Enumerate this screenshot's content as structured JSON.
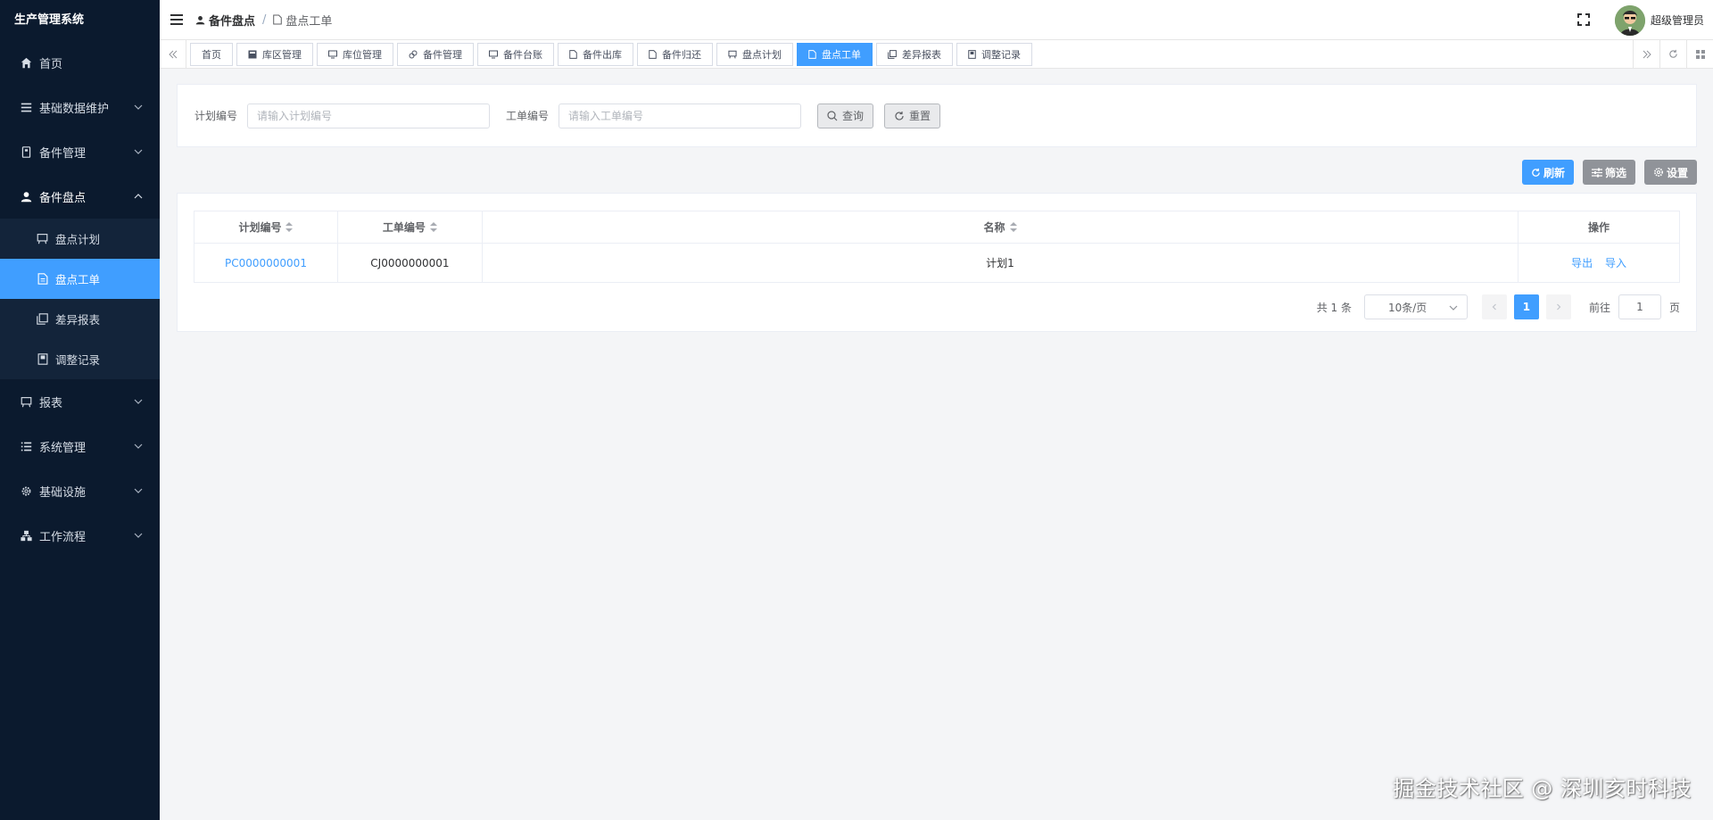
{
  "app": {
    "title": "生产管理系统"
  },
  "sidebar": {
    "items": [
      {
        "label": "首页",
        "icon": "home-icon",
        "expandable": false
      },
      {
        "label": "基础数据维护",
        "icon": "list-icon",
        "expandable": true
      },
      {
        "label": "备件管理",
        "icon": "device-icon",
        "expandable": true
      },
      {
        "label": "备件盘点",
        "icon": "user-icon",
        "expandable": true,
        "expanded": true,
        "children": [
          {
            "label": "盘点计划",
            "icon": "cart-icon"
          },
          {
            "label": "盘点工单",
            "icon": "document-icon",
            "active": true
          },
          {
            "label": "差异报表",
            "icon": "copy-icon"
          },
          {
            "label": "调整记录",
            "icon": "book-icon"
          }
        ]
      },
      {
        "label": "报表",
        "icon": "cart-icon",
        "expandable": true
      },
      {
        "label": "系统管理",
        "icon": "list-icon",
        "expandable": true
      },
      {
        "label": "基础设施",
        "icon": "gear-icon",
        "expandable": true
      },
      {
        "label": "工作流程",
        "icon": "flow-icon",
        "expandable": true
      }
    ]
  },
  "header": {
    "breadcrumb": [
      "备件盘点",
      "盘点工单"
    ],
    "username": "超级管理员"
  },
  "tags": [
    {
      "label": "首页",
      "icon": ""
    },
    {
      "label": "库区管理",
      "icon": "box-icon"
    },
    {
      "label": "库位管理",
      "icon": "monitor-icon"
    },
    {
      "label": "备件管理",
      "icon": "link-icon"
    },
    {
      "label": "备件台账",
      "icon": "monitor-icon"
    },
    {
      "label": "备件出库",
      "icon": "document-icon"
    },
    {
      "label": "备件归还",
      "icon": "document-icon"
    },
    {
      "label": "盘点计划",
      "icon": "cart-icon"
    },
    {
      "label": "盘点工单",
      "icon": "document-icon",
      "active": true
    },
    {
      "label": "差异报表",
      "icon": "copy-icon"
    },
    {
      "label": "调整记录",
      "icon": "book-icon"
    }
  ],
  "search": {
    "plan_label": "计划编号",
    "plan_placeholder": "请输入计划编号",
    "plan_value": "",
    "order_label": "工单编号",
    "order_placeholder": "请输入工单编号",
    "order_value": "",
    "query_label": "查询",
    "reset_label": "重置"
  },
  "toolbar": {
    "refresh_label": "刷新",
    "filter_label": "筛选",
    "settings_label": "设置"
  },
  "table": {
    "columns": [
      "计划编号",
      "工单编号",
      "名称",
      "操作"
    ],
    "rows": [
      {
        "plan_no": "PC0000000001",
        "order_no": "CJ0000000001",
        "name": "计划1",
        "actions": [
          "导出",
          "导入"
        ]
      }
    ]
  },
  "pagination": {
    "total_text": "共 1 条",
    "page_size": "10条/页",
    "current_page": "1",
    "goto_label": "前往",
    "goto_value": "1",
    "page_suffix": "页"
  },
  "watermark": "掘金技术社区 @ 深圳亥时科技",
  "colors": {
    "sidebar_bg": "#0b1a2e",
    "primary": "#409eff",
    "gray_button": "#909399"
  }
}
